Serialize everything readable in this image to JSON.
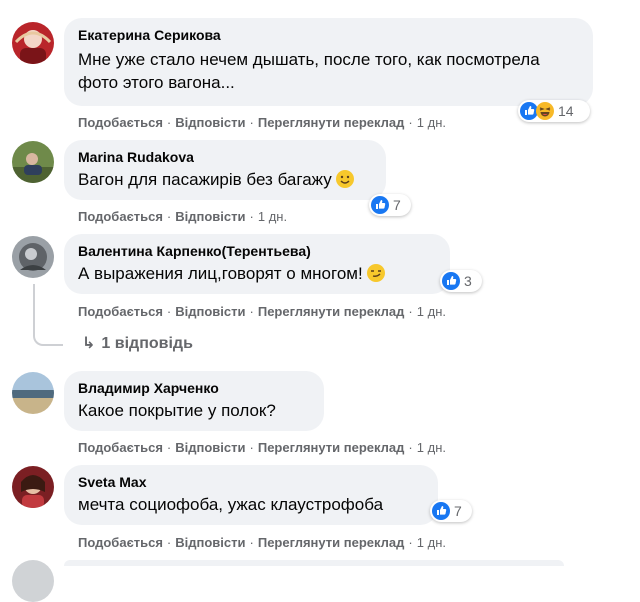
{
  "comments": [
    {
      "author": "Екатерина Серикова",
      "text": "Мне уже стало нечем дышать, после того, как посмотрела фото этого вагона...",
      "reactions": {
        "icons": [
          "like-icon",
          "haha-icon"
        ],
        "count": "14"
      },
      "actions": {
        "like": "Подобається",
        "reply": "Відповісти",
        "translate": "Переглянути переклад",
        "time": "1 дн."
      }
    },
    {
      "author": "Marina Rudakova",
      "text": "Вагон для пасажирів без багажу",
      "emoji": "slightly-smiling-face-icon",
      "reactions": {
        "icons": [
          "like-icon"
        ],
        "count": "7"
      },
      "actions": {
        "like": "Подобається",
        "reply": "Відповісти",
        "time": "1 дн."
      }
    },
    {
      "author": "Валентина Карпенко(Терентьева)",
      "text": "А выражения лиц,говорят о многом!",
      "emoji": "smirk-face-icon",
      "reactions": {
        "icons": [
          "like-icon"
        ],
        "count": "3"
      },
      "actions": {
        "like": "Подобається",
        "reply": "Відповісти",
        "translate": "Переглянути переклад",
        "time": "1 дн."
      },
      "replies_label": "1 відповідь"
    },
    {
      "author": "Владимир Харченко",
      "text": "Какое покрытие у полок?",
      "actions": {
        "like": "Подобається",
        "reply": "Відповісти",
        "translate": "Переглянути переклад",
        "time": "1 дн."
      }
    },
    {
      "author": "Sveta Max",
      "text": "мечта социофоба, ужас клаустрофоба",
      "reactions": {
        "icons": [
          "like-icon"
        ],
        "count": "7"
      },
      "actions": {
        "like": "Подобається",
        "reply": "Відповісти",
        "translate": "Переглянути переклад",
        "time": "1 дн."
      }
    }
  ],
  "colors": {
    "bubble": "#f0f2f5",
    "meta": "#65676b",
    "like_blue": "#1877f2",
    "haha_yellow": "#f7b928"
  }
}
